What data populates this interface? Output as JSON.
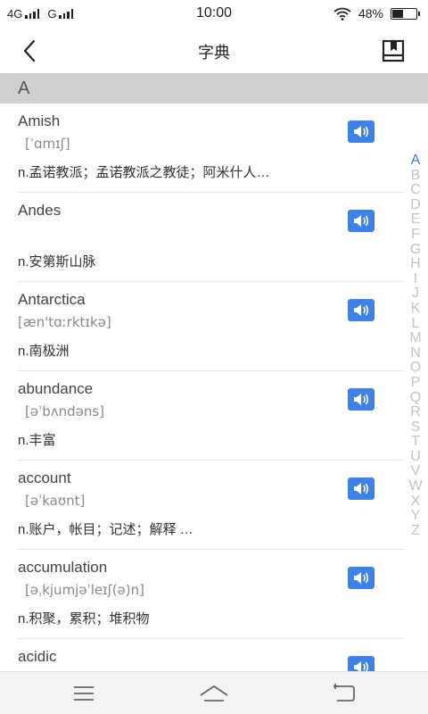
{
  "status": {
    "network1": "4G",
    "network2": "G",
    "time": "10:00",
    "battery": "48%",
    "battery_level": 0.48
  },
  "header": {
    "title": "字典"
  },
  "section": {
    "letter": "A"
  },
  "words": [
    {
      "word": "Amish",
      "phonetic": "[ˈɑmɪʃ]",
      "definition": "n.孟诺教派；孟诺教派之教徒；阿米什人…"
    },
    {
      "word": "Andes",
      "phonetic": "",
      "definition": "n.安第斯山脉"
    },
    {
      "word": "Antarctica",
      "phonetic": "[æn'tɑːrktɪkə]",
      "definition": "n.南极洲"
    },
    {
      "word": "abundance",
      "phonetic": "[əˈbʌndəns]",
      "definition": "n.丰富"
    },
    {
      "word": "account",
      "phonetic": "[əˈkaʊnt]",
      "definition": "n.账户，帐目；记述；解释 …"
    },
    {
      "word": "accumulation",
      "phonetic": "[əˌkjumjəˈleɪʃ(ə)n]",
      "definition": "n.积聚，累积；堆积物"
    },
    {
      "word": "acidic",
      "phonetic": "",
      "definition": ""
    }
  ],
  "index_letters": [
    "A",
    "B",
    "C",
    "D",
    "E",
    "F",
    "G",
    "H",
    "I",
    "J",
    "K",
    "L",
    "M",
    "N",
    "O",
    "P",
    "Q",
    "R",
    "S",
    "T",
    "U",
    "V",
    "W",
    "X",
    "Y",
    "Z"
  ],
  "icons": {
    "back": "chevron-left-icon",
    "book": "book-icon",
    "speaker": "speaker-icon",
    "menu": "menu-icon",
    "home": "home-icon",
    "return": "return-icon"
  },
  "colors": {
    "accent": "#3e82e8",
    "section_bg": "#cfcfcf",
    "index_inactive": "#c4c4c4"
  }
}
